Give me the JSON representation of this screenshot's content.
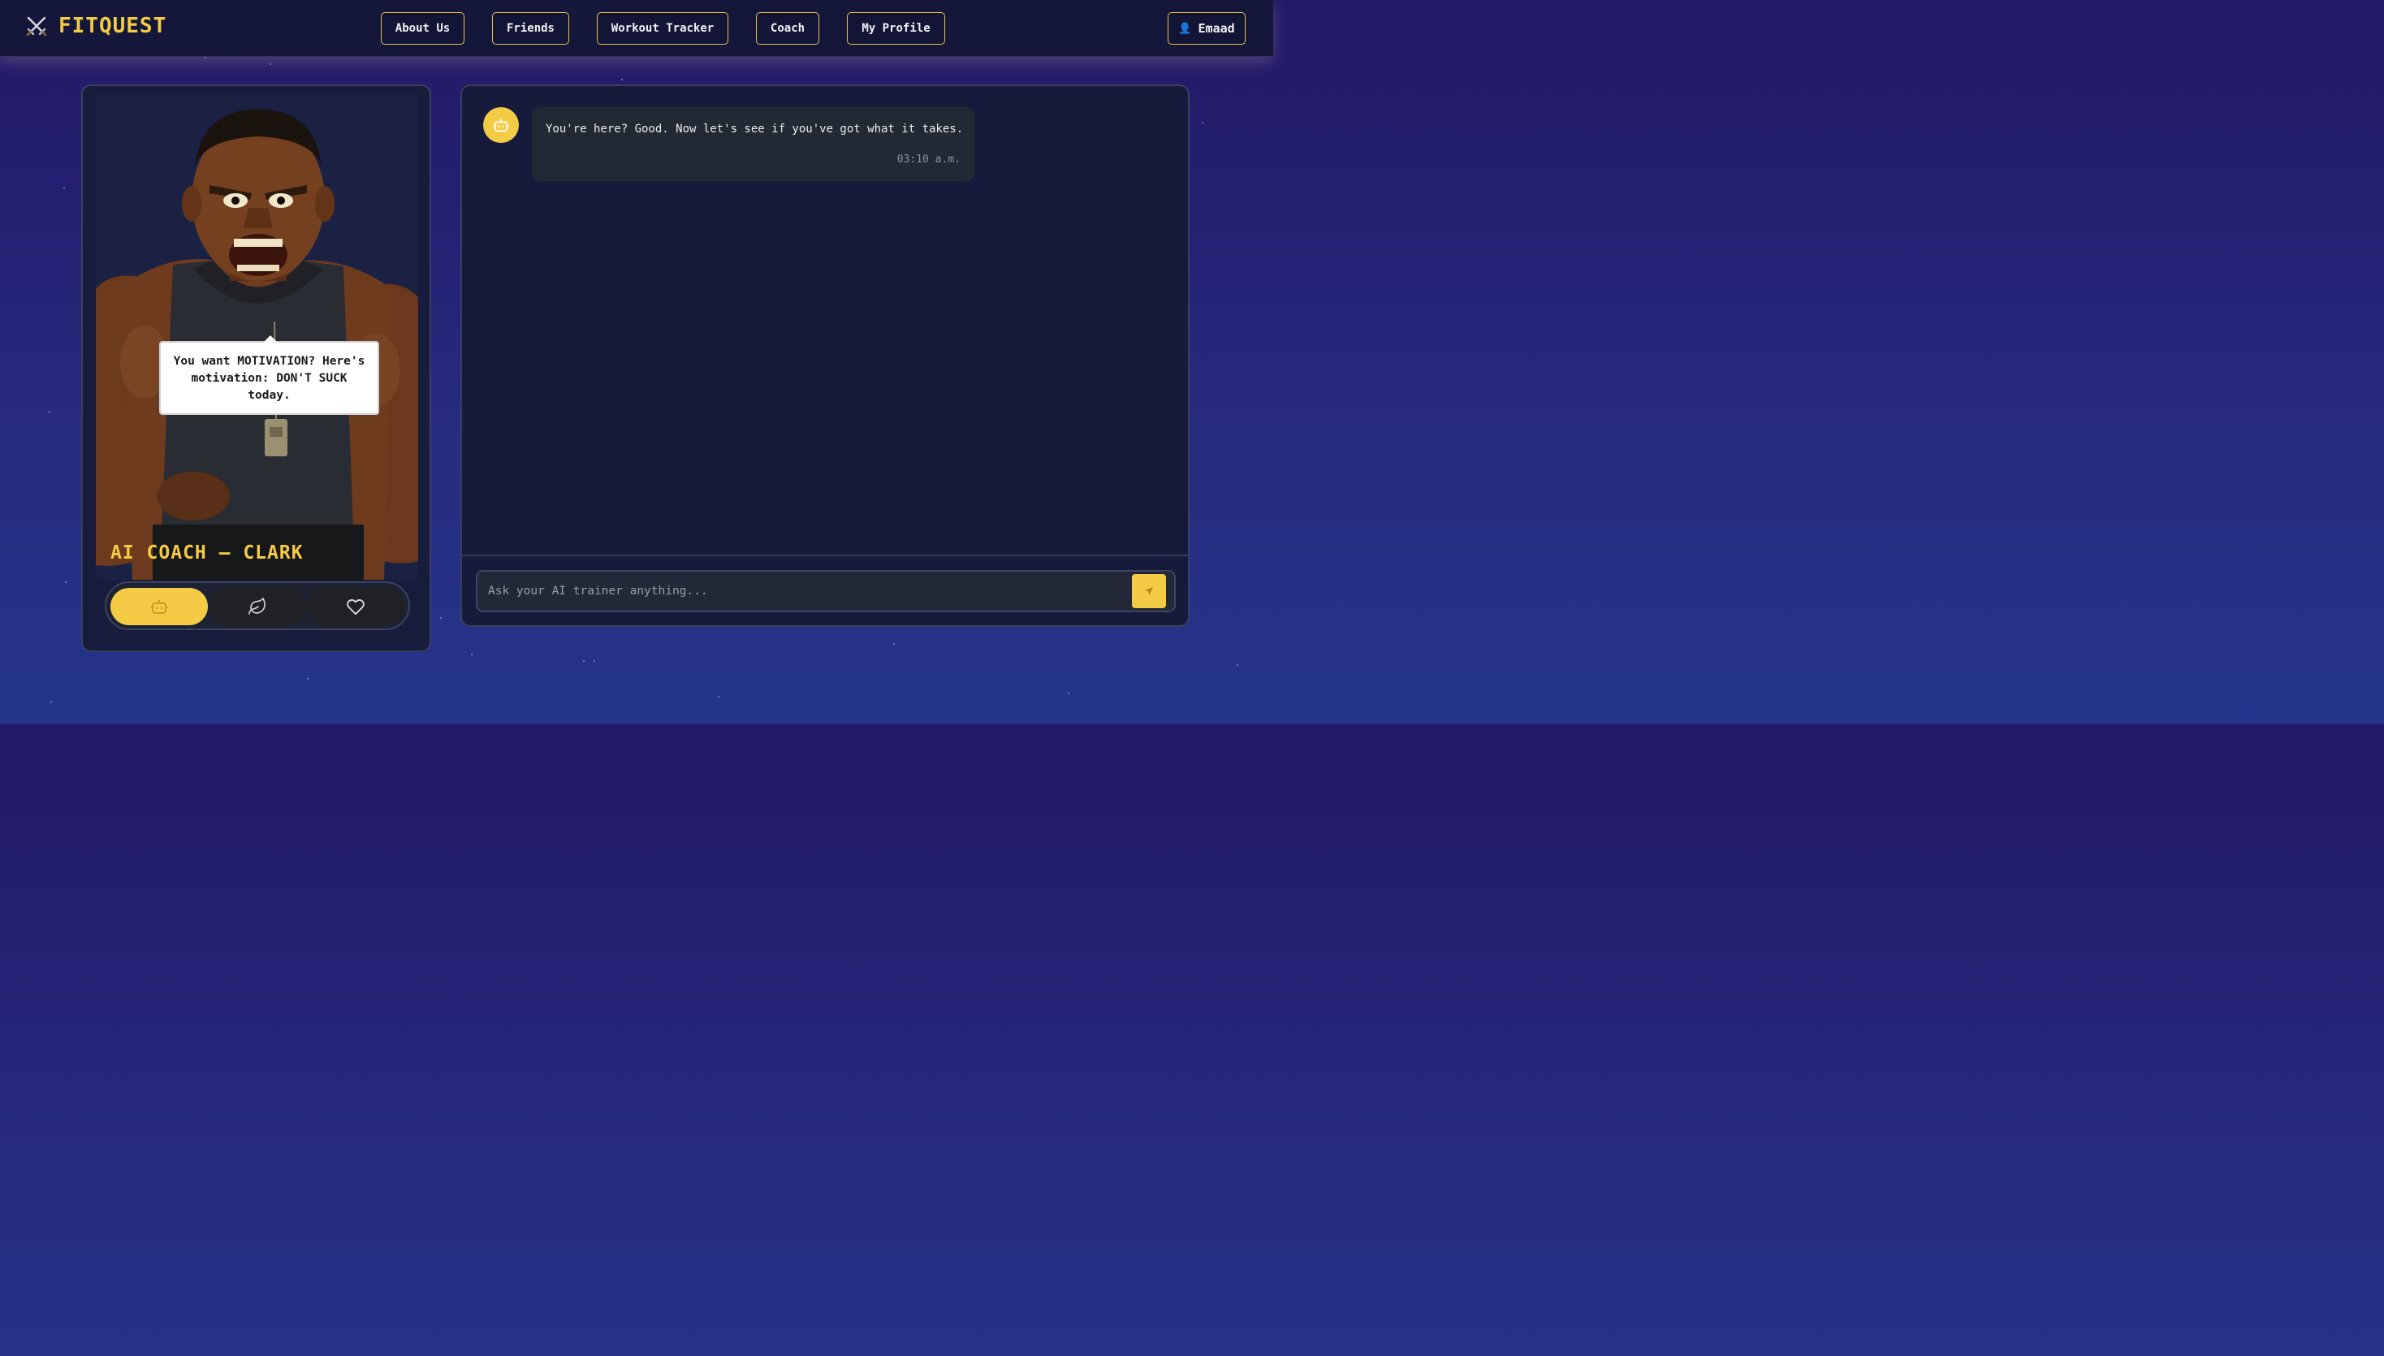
{
  "brand": {
    "name": "FITQUEST",
    "icon": "crossed-swords-icon"
  },
  "nav": {
    "items": [
      {
        "label": "About Us"
      },
      {
        "label": "Friends"
      },
      {
        "label": "Workout Tracker"
      },
      {
        "label": "Coach"
      },
      {
        "label": "My Profile"
      }
    ],
    "user": {
      "name": "Emaad",
      "icon": "user-icon"
    }
  },
  "coach": {
    "title": "AI COACH — CLARK",
    "speech": "You want MOTIVATION? Here's motivation: DON'T SUCK today.",
    "modes": [
      {
        "icon": "robot-icon",
        "active": true
      },
      {
        "icon": "leaf-icon",
        "active": false
      },
      {
        "icon": "heart-icon",
        "active": false
      }
    ]
  },
  "chat": {
    "messages": [
      {
        "sender": "bot",
        "avatar_icon": "robot-icon",
        "text": "You're here? Good. Now let's see if you've got what it takes.",
        "time": "03:10 a.m."
      }
    ],
    "input": {
      "placeholder": "Ask your AI trainer anything...",
      "value": ""
    },
    "send_icon": "send-icon"
  },
  "colors": {
    "accent": "#f3cb45",
    "nav_bg": "#14173a",
    "panel_bg": "#171c3d",
    "bubble_bg": "#222834"
  }
}
